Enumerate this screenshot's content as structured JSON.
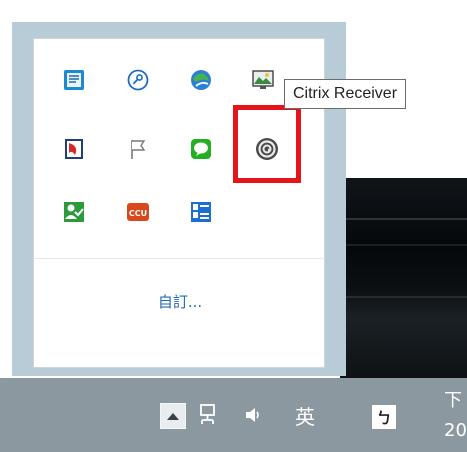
{
  "tray_flyout": {
    "icons": [
      {
        "name": "app-blue-tile-icon"
      },
      {
        "name": "magnifier-key-icon"
      },
      {
        "name": "globe-refresh-icon"
      },
      {
        "name": "photo-monitor-icon"
      },
      {
        "name": "red-document-icon"
      },
      {
        "name": "flag-icon"
      },
      {
        "name": "green-chat-icon"
      },
      {
        "name": "citrix-receiver-icon"
      },
      {
        "name": "green-user-check-icon"
      },
      {
        "name": "ccu-icon"
      },
      {
        "name": "blue-list-icon"
      }
    ],
    "ccu_label": "CCU",
    "customize_link": "自訂...",
    "tooltip": "Citrix Receiver"
  },
  "taskbar": {
    "ime_label": "英",
    "ime_mode": "ㄅ",
    "clock_line1": "下",
    "clock_line2": "20"
  },
  "colors": {
    "highlight": "#e3141a",
    "taskbar": "#8b98a0",
    "flyout_border": "#b7ccd6",
    "link": "#1f6bb8"
  }
}
